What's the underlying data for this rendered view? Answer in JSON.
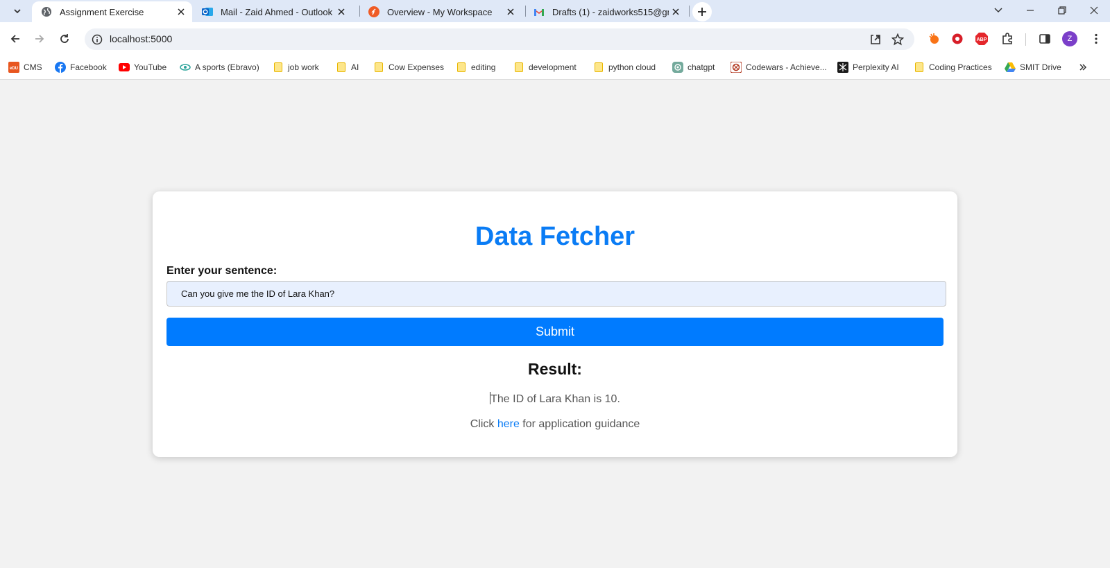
{
  "browser": {
    "tabs": [
      {
        "title": "Assignment Exercise",
        "active": true
      },
      {
        "title": "Mail - Zaid Ahmed - Outlook",
        "active": false
      },
      {
        "title": "Overview - My Workspace",
        "active": false
      },
      {
        "title": "Drafts (1) - zaidworks515@gmai",
        "active": false
      }
    ],
    "url": "localhost:5000",
    "profile_initial": "Z",
    "extensions": {
      "adblock_label": "ABP"
    }
  },
  "bookmarks": [
    {
      "label": "CMS",
      "icon": "cms-icon"
    },
    {
      "label": "Facebook",
      "icon": "facebook-icon"
    },
    {
      "label": "YouTube",
      "icon": "youtube-icon"
    },
    {
      "label": "A sports (Ebravo)",
      "icon": "eye-icon"
    },
    {
      "label": "job work",
      "icon": "folder-icon"
    },
    {
      "label": "AI",
      "icon": "folder-icon"
    },
    {
      "label": "Cow Expenses",
      "icon": "folder-icon"
    },
    {
      "label": "editing",
      "icon": "folder-icon"
    },
    {
      "label": "development",
      "icon": "folder-icon"
    },
    {
      "label": "python cloud",
      "icon": "folder-icon"
    },
    {
      "label": "chatgpt",
      "icon": "chatgpt-icon"
    },
    {
      "label": "Codewars - Achieve...",
      "icon": "codewars-icon"
    },
    {
      "label": "Perplexity AI",
      "icon": "perplexity-icon"
    },
    {
      "label": "Coding Practices",
      "icon": "folder-icon"
    },
    {
      "label": "SMIT Drive",
      "icon": "drive-icon"
    }
  ],
  "page": {
    "title": "Data Fetcher",
    "input_label": "Enter your sentence:",
    "input_value": "Can you give me the ID of Lara Khan?",
    "submit_label": "Submit",
    "result_heading": "Result:",
    "result_text": "The ID of Lara Khan is 10.",
    "guide_prefix": "Click ",
    "guide_link": "here",
    "guide_suffix": " for application guidance"
  },
  "colors": {
    "accent": "#007bff",
    "title": "#0a7cf5",
    "background": "#f2f2f2",
    "input_bg": "#e8f0fe"
  }
}
